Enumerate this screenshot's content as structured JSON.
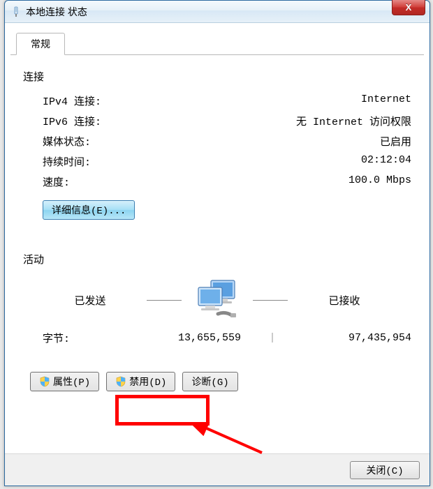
{
  "window": {
    "title": "本地连接 状态",
    "close_x": "X"
  },
  "tab": {
    "general": "常规"
  },
  "connection": {
    "heading": "连接",
    "ipv4_label": "IPv4 连接",
    "ipv4_value": "Internet",
    "ipv6_label": "IPv6 连接",
    "ipv6_value": "无 Internet 访问权限",
    "media_label": "媒体状态",
    "media_value": "已启用",
    "duration_label": "持续时间",
    "duration_value": "02:12:04",
    "speed_label": "速度",
    "speed_value": "100.0 Mbps",
    "details_button": "详细信息(E)..."
  },
  "activity": {
    "heading": "活动",
    "sent_label": "已发送",
    "received_label": "已接收",
    "bytes_label": "字节",
    "bytes_sent": "13,655,559",
    "bytes_received": "97,435,954"
  },
  "buttons": {
    "properties": "属性(P)",
    "disable": "禁用(D)",
    "diagnose": "诊断(G)",
    "close": "关闭(C)"
  }
}
